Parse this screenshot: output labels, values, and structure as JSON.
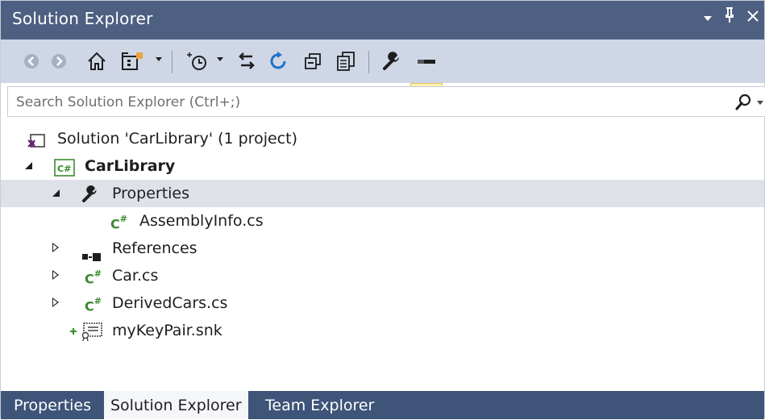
{
  "window": {
    "title": "Solution Explorer",
    "controls": {
      "dropdown": "▾",
      "pin": "ᵖ",
      "close": "✕"
    }
  },
  "toolbar": {
    "buttons": [
      {
        "name": "back-button",
        "icon": "back-icon"
      },
      {
        "name": "forward-button",
        "icon": "forward-icon"
      },
      {
        "name": "home-button",
        "icon": "home-icon"
      },
      {
        "name": "switch-views-button",
        "icon": "switch-views-icon"
      },
      {
        "name": "pending-changes-filter-button",
        "icon": "pending-changes-icon"
      },
      {
        "name": "sync-with-active-document-button",
        "icon": "sync-icon"
      },
      {
        "name": "refresh-button",
        "icon": "refresh-icon"
      },
      {
        "name": "collapse-all-button",
        "icon": "collapse-all-icon"
      },
      {
        "name": "show-all-files-button",
        "icon": "show-all-files-icon"
      },
      {
        "name": "properties-button",
        "icon": "wrench-icon"
      },
      {
        "name": "preview-selected-items-button",
        "icon": "preview-icon"
      }
    ]
  },
  "search": {
    "placeholder": "Search Solution Explorer (Ctrl+;)",
    "value": ""
  },
  "tree": {
    "solution": "Solution 'CarLibrary' (1 project)",
    "project": "CarLibrary",
    "properties": "Properties",
    "assemblyinfo": "AssemblyInfo.cs",
    "references": "References",
    "car": "Car.cs",
    "derivedcars": "DerivedCars.cs",
    "keypair": "myKeyPair.snk",
    "cs_badge": "C#",
    "selected": "Properties"
  },
  "tabs": [
    {
      "label": "Properties",
      "active": false
    },
    {
      "label": "Solution Explorer",
      "active": true
    },
    {
      "label": "Team Explorer",
      "active": false
    }
  ],
  "colors": {
    "titlebar": "#4d6082",
    "toolbar": "#cfd6e5",
    "tab_strip": "#3e5478",
    "selection": "#dfe1e9",
    "csharp": "#3a8a2e",
    "vs_purple": "#68217a"
  }
}
